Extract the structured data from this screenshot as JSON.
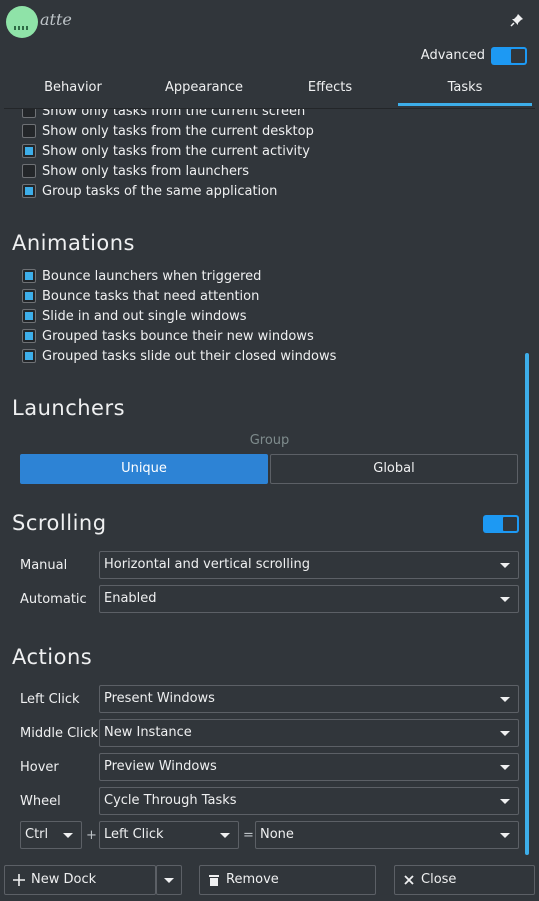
{
  "app": {
    "logo_text": "atte",
    "advanced_label": "Advanced"
  },
  "tabs": [
    {
      "label": "Behavior"
    },
    {
      "label": "Appearance"
    },
    {
      "label": "Effects"
    },
    {
      "label": "Tasks",
      "active": true
    }
  ],
  "filters": [
    {
      "label": "Show only tasks from the current screen",
      "checked": false
    },
    {
      "label": "Show only tasks from the current desktop",
      "checked": false
    },
    {
      "label": "Show only tasks from the current activity",
      "checked": true
    },
    {
      "label": "Show only tasks from launchers",
      "checked": false
    },
    {
      "label": "Group tasks of the same application",
      "checked": true
    }
  ],
  "animations": {
    "title": "Animations",
    "items": [
      {
        "label": "Bounce launchers when triggered",
        "checked": true
      },
      {
        "label": "Bounce tasks that need attention",
        "checked": true
      },
      {
        "label": "Slide in and out single windows",
        "checked": true
      },
      {
        "label": "Grouped tasks bounce their new windows",
        "checked": true
      },
      {
        "label": "Grouped tasks slide out their closed windows",
        "checked": true
      }
    ]
  },
  "launchers": {
    "title": "Launchers",
    "group_label": "Group",
    "unique": "Unique",
    "global": "Global"
  },
  "scrolling": {
    "title": "Scrolling",
    "manual_label": "Manual",
    "manual_value": "Horizontal and vertical scrolling",
    "automatic_label": "Automatic",
    "automatic_value": "Enabled"
  },
  "actions": {
    "title": "Actions",
    "left_click_label": "Left Click",
    "left_click_value": "Present Windows",
    "middle_click_label": "Middle Click",
    "middle_click_value": "New Instance",
    "hover_label": "Hover",
    "hover_value": "Preview Windows",
    "wheel_label": "Wheel",
    "wheel_value": "Cycle Through Tasks",
    "modifier_value": "Ctrl",
    "plus": "+",
    "button_value": "Left Click",
    "equals": "=",
    "result_value": "None"
  },
  "footer": {
    "new_dock": "New Dock",
    "remove": "Remove",
    "close": "Close"
  }
}
